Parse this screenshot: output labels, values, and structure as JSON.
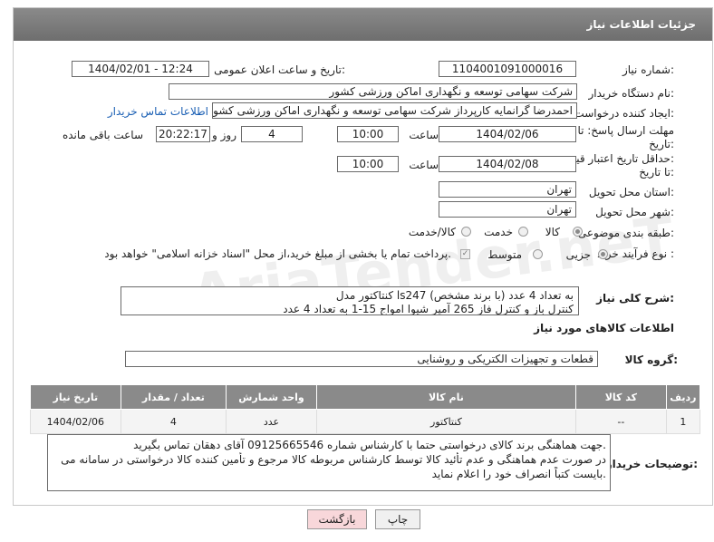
{
  "header": {
    "title": "جزئیات اطلاعات نیاز"
  },
  "fields": {
    "need_number_label": "شماره نیاز:",
    "need_number": "1104001091000016",
    "announce_label": "تاریخ و ساعت اعلان عمومی:",
    "announce_value": "1404/02/01 - 12:24",
    "buyer_org_label": "نام دستگاه خریدار:",
    "buyer_org": "شرکت سهامی توسعه و نگهداری اماکن ورزشی کشور",
    "creator_label": "ایجاد کننده درخواست:",
    "creator": "احمدرضا گرانمایه کارپرداز شرکت سهامی توسعه و نگهداری اماکن ورزشی کشو",
    "contact_link": "اطلاعات تماس خریدار",
    "deadline_label_1": "مهلت ارسال پاسخ: تا",
    "deadline_label_2": "تاریخ:",
    "deadline_date": "1404/02/06",
    "time_label": "ساعت",
    "deadline_time": "10:00",
    "days_value": "4",
    "days_label": "روز و",
    "remaining_time": "20:22:17",
    "remaining_label": "ساعت باقی مانده",
    "validity_label_1": "حداقل تاریخ اعتبار قیمت:",
    "validity_label_2": "تا تاریخ:",
    "validity_date": "1404/02/08",
    "validity_time": "10:00",
    "province_label": "استان محل تحویل:",
    "province": "تهران",
    "city_label": "شهر محل تحویل:",
    "city": "تهران",
    "category_label": "طبقه بندی موضوعی:",
    "category_options": [
      "کالا",
      "خدمت",
      "کالا/خدمت"
    ],
    "category_selected": "کالا",
    "process_label": "نوع فرآیند خرید :",
    "process_options": [
      "جزیی",
      "متوسط"
    ],
    "process_selected": "جزیی",
    "payment_note": "پرداخت تمام یا بخشی از مبلغ خرید،از محل \"اسناد خزانه اسلامی\" خواهد بود."
  },
  "description": {
    "label": "شرح کلی نیاز:",
    "line1": "کنتاکتور مدل ls247 به تعداد 4 عدد (با برند مشخص)",
    "line2": "کنترل باز و کنترل فاز 265 آمپر شیوا امواج 15-1 به تعداد 4 عدد"
  },
  "goods_section": {
    "title": "اطلاعات کالاهای مورد نیاز",
    "group_label": "گروه کالا:",
    "group_value": "قطعات و تجهیزات الکتریکی و روشنایی"
  },
  "table": {
    "headers": [
      "ردیف",
      "کد کالا",
      "نام کالا",
      "واحد شمارش",
      "تعداد / مقدار",
      "تاریخ نیاز"
    ],
    "rows": [
      {
        "row": "1",
        "code": "--",
        "name": "کنتاکتور",
        "unit": "عدد",
        "qty": "4",
        "date": "1404/02/06"
      }
    ]
  },
  "buyer_notes": {
    "label": "توضیحات خریدار:",
    "line1": "جهت هماهنگی برند کالای درخواستی حتما با کارشناس شماره 09125665546 آقای دهقان تماس بگیرید.",
    "line2": "در صورت عدم هماهنگی و عدم تأئید کالا توسط کارشناس مربوطه کالا مرجوع و تأمین کننده کالا درخواستی در سامانه می",
    "line3": "بایست کتباً انصراف خود را اعلام نماید."
  },
  "buttons": {
    "print": "چاپ",
    "back": "بازگشت"
  },
  "watermark": "AriaTender.neT",
  "colors": {
    "header_bg": "#7a7a7a",
    "link": "#1a5fb4",
    "back_button_bg": "#f8d7da"
  }
}
